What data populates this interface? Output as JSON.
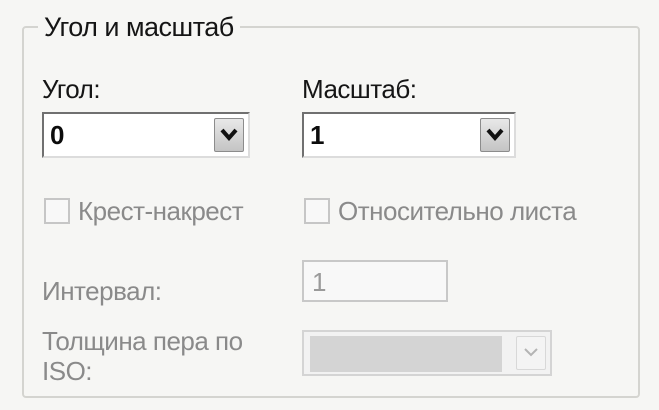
{
  "group": {
    "title": "Угол и масштаб"
  },
  "angle": {
    "label": "Угол:",
    "value": "0"
  },
  "scale": {
    "label": "Масштаб:",
    "value": "1"
  },
  "crosshatch": {
    "label": "Крест-накрест",
    "checked": false,
    "enabled": false
  },
  "relative_to_sheet": {
    "label": "Относительно листа",
    "checked": false,
    "enabled": false
  },
  "interval": {
    "label": "Интервал:",
    "value": "1",
    "enabled": false
  },
  "iso_pen_width": {
    "label_line1": "Толщина пера по",
    "label_line2": "ISO:",
    "value": "",
    "enabled": false
  },
  "icons": {
    "dropdown": "chevron-down-icon"
  }
}
